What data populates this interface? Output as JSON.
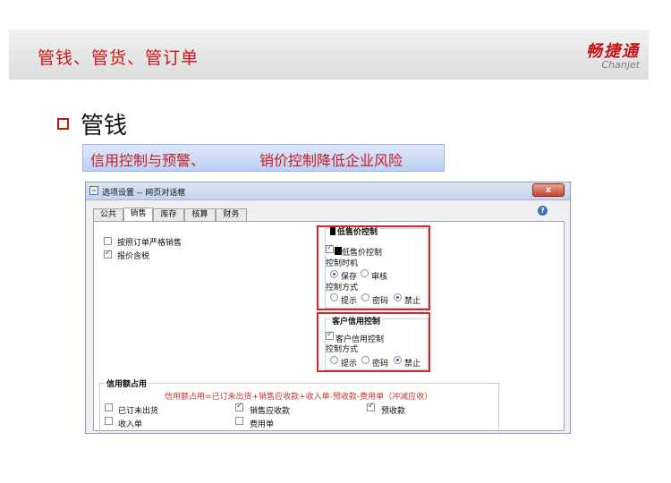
{
  "slide": {
    "title": "管钱、管货、管订单",
    "logo_cn": "畅捷通",
    "logo_en": "Chanjet",
    "heading": "管钱",
    "sub_left": "信用控制与预警、",
    "sub_right": "销价控制降低企业风险"
  },
  "dialog": {
    "title": "选项设置 -- 网页对话框",
    "close": "x",
    "help": "?",
    "tabs": [
      {
        "label": "公共"
      },
      {
        "label": "销售",
        "active": true
      },
      {
        "label": "库存"
      },
      {
        "label": "核算"
      },
      {
        "label": "财务"
      }
    ],
    "options": [
      {
        "label": "按照订单严格销售",
        "checked": false
      },
      {
        "label": "报价含税",
        "checked": true
      }
    ],
    "low_price": {
      "group_title": "低售价控制",
      "enable_label": "低售价控制",
      "enable_checked": true,
      "timing_label": "控制时机",
      "timing_options": [
        {
          "label": "保存",
          "checked": true
        },
        {
          "label": "审核",
          "checked": false
        }
      ],
      "mode_label": "控制方式",
      "mode_options": [
        {
          "label": "提示",
          "checked": false
        },
        {
          "label": "密码",
          "checked": false
        },
        {
          "label": "禁止",
          "checked": true
        }
      ]
    },
    "credit": {
      "group_title": "客户信用控制",
      "enable_label": "客户信用控制",
      "enable_checked": true,
      "mode_label": "控制方式",
      "mode_options": [
        {
          "label": "提示",
          "checked": false
        },
        {
          "label": "密码",
          "checked": false
        },
        {
          "label": "禁止",
          "checked": true
        }
      ]
    },
    "credit_usage": {
      "group_title": "信用额占用",
      "formula": "信用额占用=已订未出货+销售应收款+收入单-预收款-费用单（冲减应收）",
      "items": [
        {
          "label": "已订未出货",
          "checked": false
        },
        {
          "label": "销售应收款",
          "checked": true
        },
        {
          "label": "预收款",
          "checked": true
        },
        {
          "label": "收入单",
          "checked": false
        },
        {
          "label": "费用单",
          "checked": false
        }
      ]
    }
  }
}
